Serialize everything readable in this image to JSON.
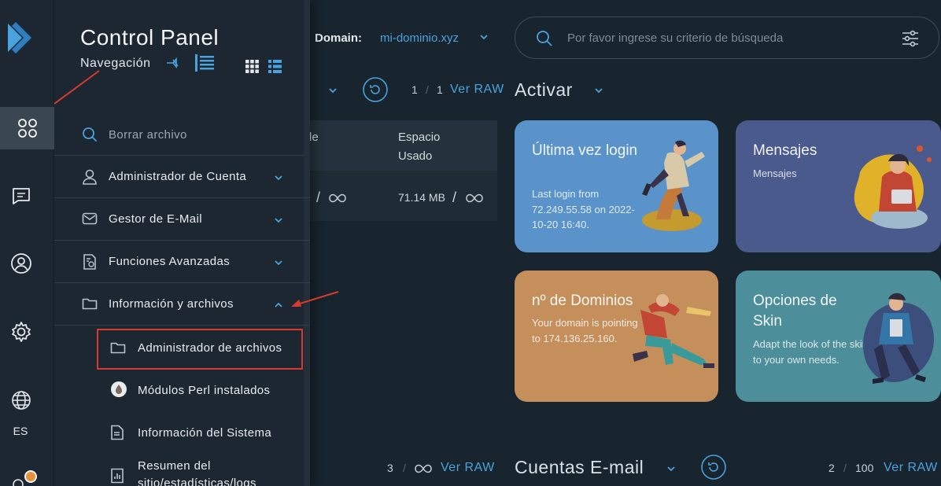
{
  "rail": {
    "items": [
      {
        "name": "dashboard-icon"
      },
      {
        "name": "messages-icon"
      },
      {
        "name": "account-icon"
      },
      {
        "name": "settings-icon"
      },
      {
        "name": "globe-icon"
      }
    ],
    "language": "ES"
  },
  "nav": {
    "title": "Control Panel",
    "subtitle": "Navegación",
    "search_placeholder": "Borrar archivo",
    "items": [
      {
        "label": "Administrador de Cuenta",
        "icon": "user-icon"
      },
      {
        "label": "Gestor de E-Mail",
        "icon": "mail-icon"
      },
      {
        "label": "Funciones Avanzadas",
        "icon": "advanced-icon"
      },
      {
        "label": "Información y archivos",
        "icon": "folder-icon"
      }
    ],
    "subitems": [
      {
        "label": "Administrador de archivos",
        "icon": "folder-icon"
      },
      {
        "label": "Módulos Perl instalados",
        "icon": "perl-icon"
      },
      {
        "label": "Información del Sistema",
        "icon": "document-icon"
      },
      {
        "label": "Resumen del",
        "label2": "sitio/estadísticas/logs",
        "icon": "chart-icon"
      }
    ]
  },
  "topbar": {
    "domain_label": "Domain:",
    "domain_value": "mi-dominio.xyz",
    "search_placeholder": "Por favor ingrese su criterio de búsqueda"
  },
  "main": {
    "stats_top": {
      "used": "1",
      "total": "1",
      "ver_raw": "Ver RAW"
    },
    "section_activar": "Activar",
    "table": {
      "header_partial": "de",
      "header_espacio": "Espacio",
      "header_usado": "Usado",
      "row_value": "71.14 MB",
      "sep": "/"
    },
    "cards": [
      {
        "title": "Última vez login",
        "body": "Last login from 72.249.55.58 on 2022-10-20 16:40.",
        "color": "#5a93c9"
      },
      {
        "title": "Mensajes",
        "body": "Mensajes",
        "color": "#4b5a8d"
      },
      {
        "title": "nº de Dominios",
        "body": "Your domain is pointing to 174.136.25.160.",
        "color": "#c58f5b"
      },
      {
        "title": "Opciones de Skin",
        "body": "Adapt the look of the skin to your own needs.",
        "color": "#4d8e9b"
      }
    ],
    "stats_bottom_left": {
      "used": "3",
      "ver_raw": "Ver RAW"
    },
    "section_email": "Cuentas E-mail",
    "stats_bottom_right": {
      "used": "2",
      "total": "100",
      "ver_raw": "Ver RAW"
    },
    "partial_label": "o"
  },
  "colors": {
    "accent": "#4aa3df",
    "highlight": "#d93a30"
  }
}
